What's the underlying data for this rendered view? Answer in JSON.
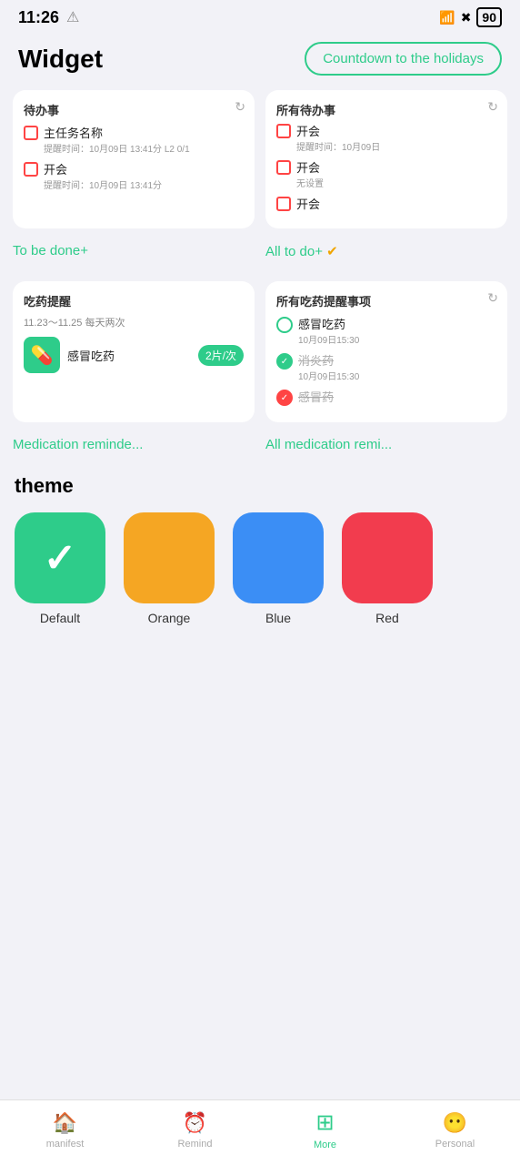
{
  "statusBar": {
    "time": "11:26",
    "alertIcon": "⚠",
    "wifiIcon": "WiFi",
    "batteryLevel": "90"
  },
  "header": {
    "title": "Widget",
    "countdownLabel": "Countdown to the holidays"
  },
  "widgetTodo": {
    "title": "待办事",
    "items": [
      {
        "name": "主任务名称",
        "subtitle": "提醒时间：10月09日 13:41分 L2 0/1"
      },
      {
        "name": "开会",
        "subtitle": "提醒时间：10月09日 13:41分"
      }
    ]
  },
  "widgetAllTodo": {
    "title": "所有待办事",
    "items": [
      {
        "name": "开会",
        "subtitle": "提醒时间：10月09日"
      },
      {
        "name": "开会",
        "subtitle": "无设置"
      },
      {
        "name": "开会",
        "subtitle": ""
      }
    ]
  },
  "widgetMed": {
    "title": "吃药提醒",
    "dateRange": "11.23～11.25 每天两次",
    "name": "感冒吃药",
    "dose": "2片/次"
  },
  "widgetAllMed": {
    "title": "所有吃药提醒事项",
    "items": [
      {
        "name": "感冒吃药",
        "time": "10月09日15:30",
        "checked": "none"
      },
      {
        "name": "消炎药",
        "time": "10月09日15:30",
        "checked": "green"
      },
      {
        "name": "感冒药",
        "time": "",
        "checked": "red"
      }
    ]
  },
  "widgetLabels": {
    "todoBtnLabel": "To be done+",
    "allTodoBtnLabel": "All to do+",
    "medBtnLabel": "Medication reminde...",
    "allMedBtnLabel": "All medication remi..."
  },
  "theme": {
    "sectionTitle": "theme",
    "colors": [
      {
        "name": "Default",
        "hex": "#2ecc8a",
        "showCheck": true
      },
      {
        "name": "Orange",
        "hex": "#f5a623",
        "showCheck": false
      },
      {
        "name": "Blue",
        "hex": "#3b8ef5",
        "showCheck": false
      },
      {
        "name": "Red",
        "hex": "#f23c4e",
        "showCheck": false
      }
    ]
  },
  "bottomNav": {
    "items": [
      {
        "label": "manifest",
        "icon": "🏠",
        "active": false
      },
      {
        "label": "Remind",
        "icon": "⏰",
        "active": false
      },
      {
        "label": "More",
        "icon": "⊞",
        "active": true
      },
      {
        "label": "Personal",
        "icon": "😶",
        "active": false
      }
    ]
  }
}
